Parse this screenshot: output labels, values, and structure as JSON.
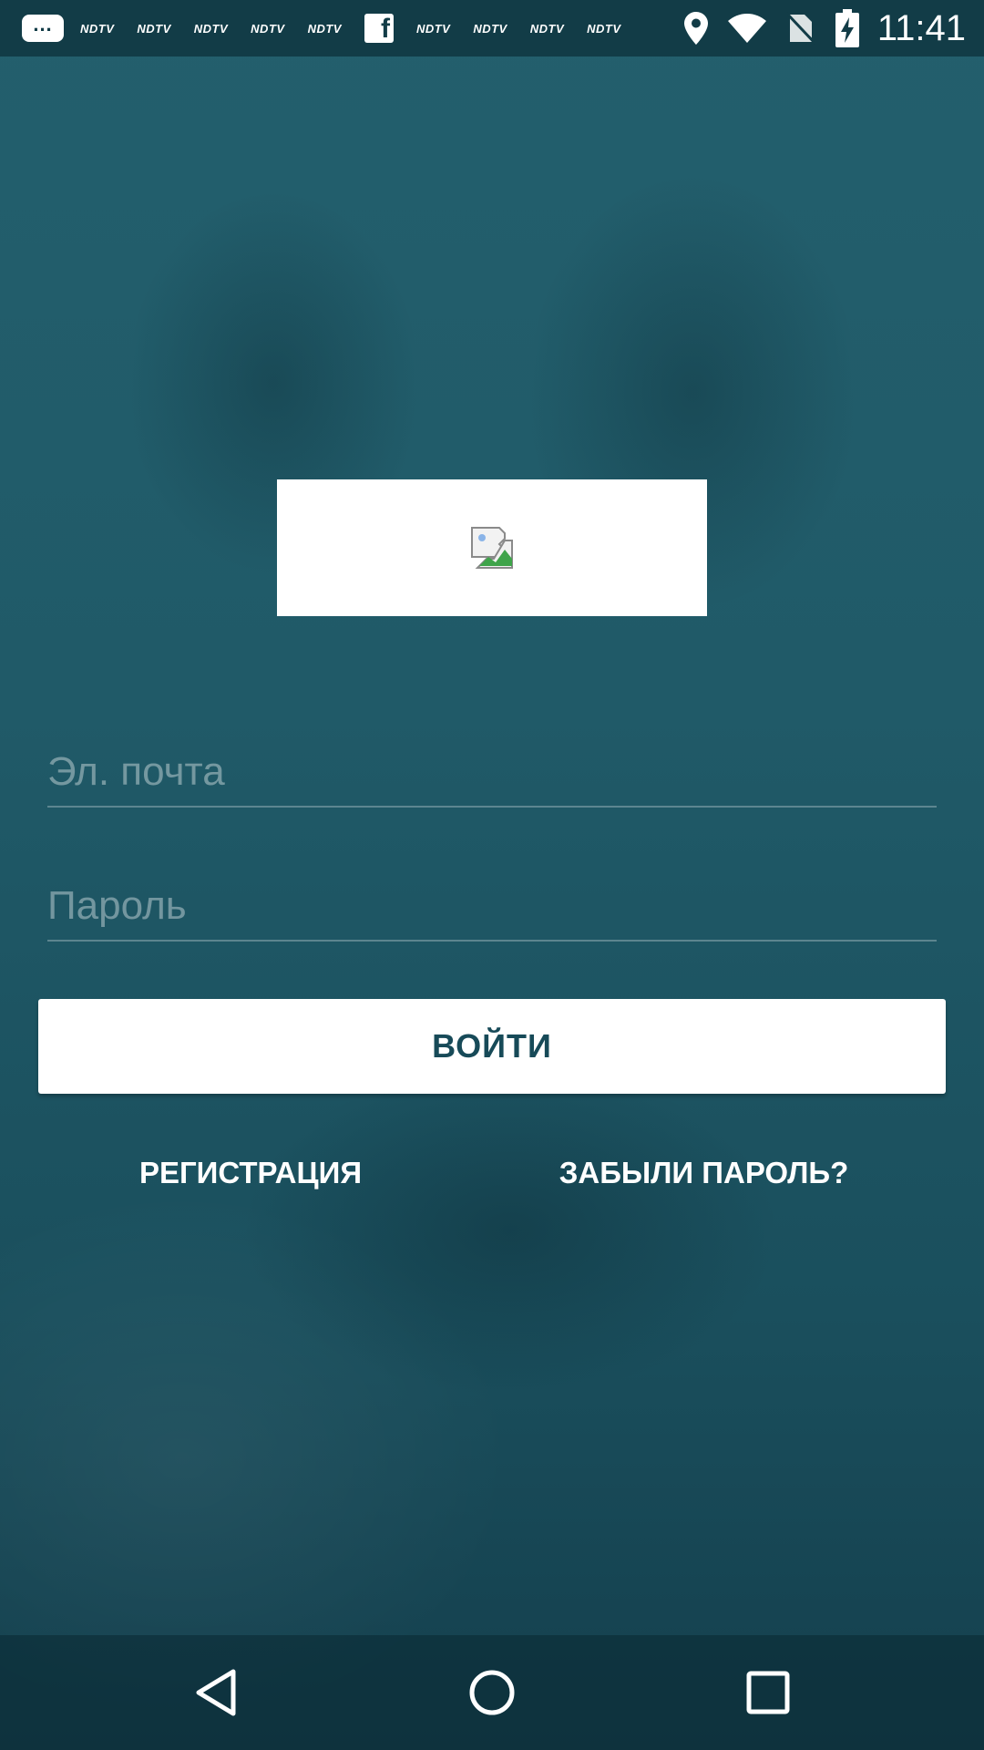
{
  "status_bar": {
    "notification_icons": [
      "NDTV",
      "NDTV",
      "NDTV",
      "NDTV",
      "NDTV",
      "facebook-icon",
      "NDTV",
      "NDTV",
      "NDTV",
      "NDTV"
    ],
    "ndtv_label": "NDTV",
    "time": "11:41",
    "icons": [
      "location-icon",
      "wifi-icon",
      "no-sim-icon",
      "battery-charging-icon"
    ]
  },
  "logo": {
    "icon": "broken-image-icon"
  },
  "form": {
    "email_placeholder": "Эл. почта",
    "password_placeholder": "Пароль",
    "login_label": "ВОЙТИ",
    "register_label": "РЕГИСТРАЦИЯ",
    "forgot_label": "ЗАБЫЛИ ПАРОЛЬ?"
  },
  "nav_bar": {
    "icons": [
      "back-icon",
      "home-icon",
      "recents-icon"
    ]
  },
  "colors": {
    "background": "#1d5563",
    "status_bar": "#123c47",
    "button_text": "#174a58"
  }
}
